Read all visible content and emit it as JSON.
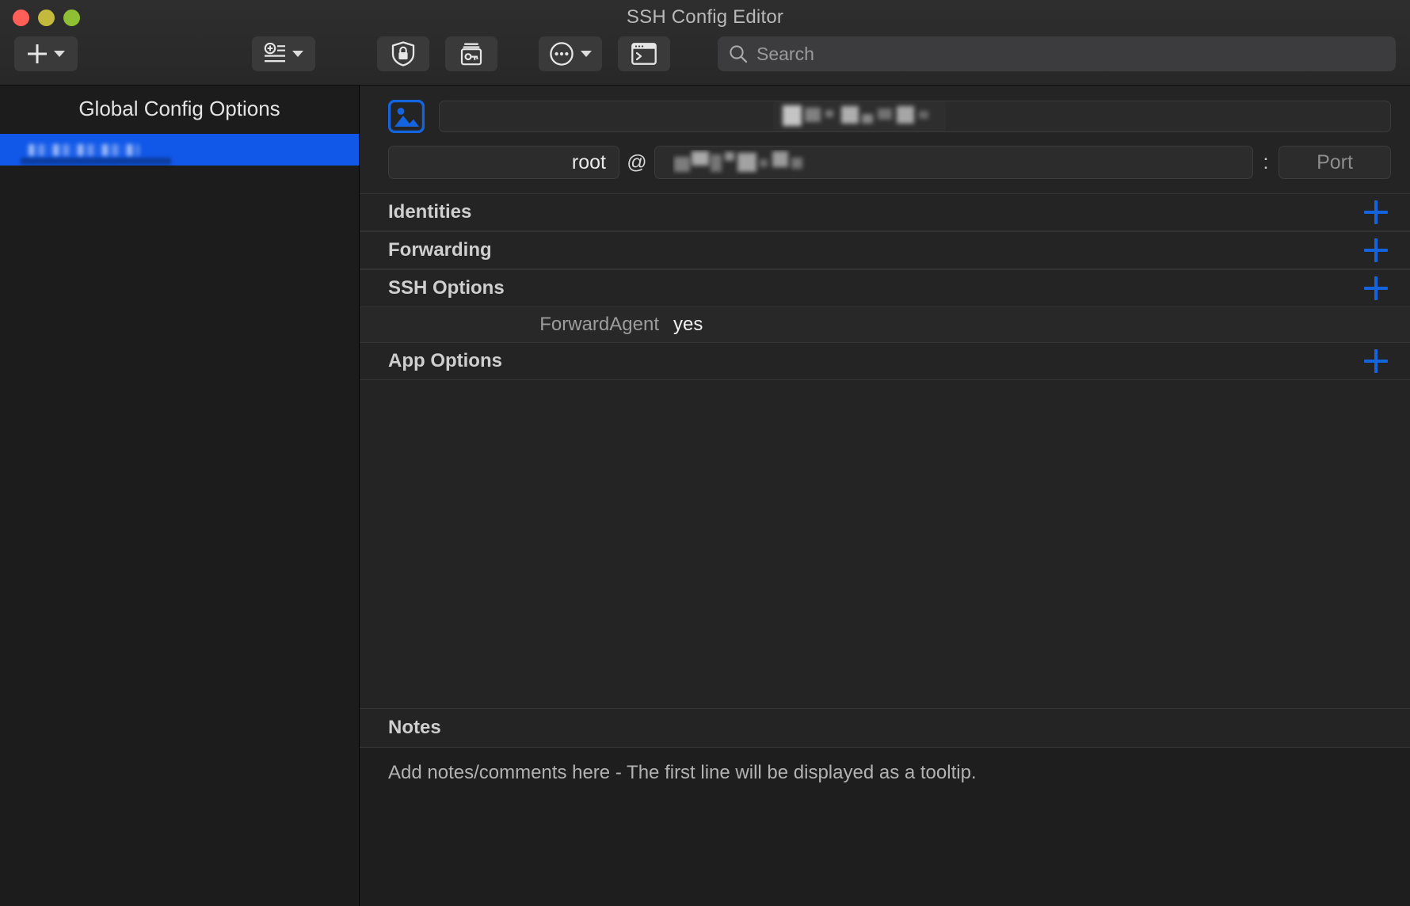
{
  "window": {
    "title": "SSH Config Editor",
    "controls": [
      "close",
      "minimize",
      "zoom"
    ]
  },
  "toolbar": {
    "add_button": {
      "label": "+",
      "icon": "plus-icon",
      "has_menu": true
    },
    "add_list_button": {
      "icon": "list-add-icon",
      "has_menu": true
    },
    "security_button": {
      "icon": "shield-lock-icon"
    },
    "keychain_button": {
      "icon": "keychain-key-icon"
    },
    "more_button": {
      "icon": "ellipsis-circle-icon",
      "has_menu": true
    },
    "terminal_button": {
      "icon": "terminal-window-icon"
    },
    "search": {
      "icon": "search-icon",
      "placeholder": "Search",
      "value": ""
    }
  },
  "sidebar": {
    "title": "Global Config Options",
    "items": [
      {
        "label": "",
        "redacted": true,
        "selected": true
      }
    ]
  },
  "detail": {
    "name_row": {
      "icon": "image-placeholder-icon",
      "name_value": "",
      "name_placeholder": "",
      "overlay_redacted": true
    },
    "host_row": {
      "user": "root",
      "at": "@",
      "host": "",
      "host_redacted": true,
      "separator": ":",
      "port_placeholder": "Port",
      "port": ""
    },
    "sections": [
      {
        "id": "identities",
        "title": "Identities",
        "add_icon": "plus-icon",
        "rows": []
      },
      {
        "id": "forwarding",
        "title": "Forwarding",
        "add_icon": "plus-icon",
        "rows": []
      },
      {
        "id": "ssh-options",
        "title": "SSH Options",
        "add_icon": "plus-icon",
        "rows": [
          {
            "key": "ForwardAgent",
            "value": "yes"
          }
        ]
      },
      {
        "id": "app-options",
        "title": "App Options",
        "add_icon": "plus-icon",
        "rows": []
      }
    ],
    "notes": {
      "title": "Notes",
      "placeholder": "Add notes/comments here - The first line will be displayed as a tooltip.",
      "value": ""
    }
  },
  "colors": {
    "accent_blue": "#1464e0",
    "selection_blue": "#1158e8",
    "window_bg": "#1e1e1e",
    "detail_bg": "#242424",
    "sidebar_bg": "#1c1c1c",
    "titlebar_bg": "#2e2e2e",
    "close_red": "#ff5f57",
    "min_yellow": "#c3b93c",
    "zoom_green": "#8fbf34"
  }
}
